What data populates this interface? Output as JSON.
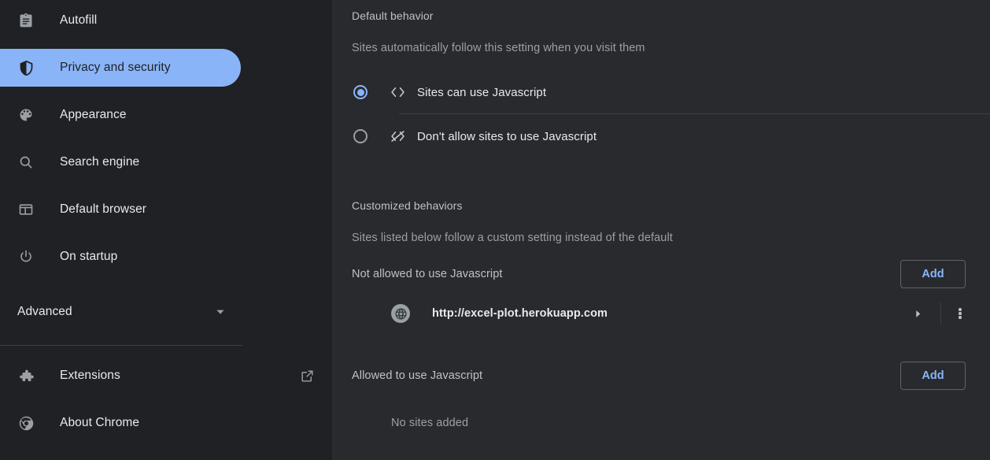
{
  "sidebar": {
    "items": [
      {
        "label": "Autofill",
        "icon": "clipboard-icon",
        "selected": false
      },
      {
        "label": "Privacy and security",
        "icon": "shield-icon",
        "selected": true
      },
      {
        "label": "Appearance",
        "icon": "palette-icon",
        "selected": false
      },
      {
        "label": "Search engine",
        "icon": "search-icon",
        "selected": false
      },
      {
        "label": "Default browser",
        "icon": "browser-window-icon",
        "selected": false
      },
      {
        "label": "On startup",
        "icon": "power-icon",
        "selected": false
      }
    ],
    "advanced": {
      "label": "Advanced",
      "icon": "chevron-down-icon"
    },
    "footer": [
      {
        "label": "Extensions",
        "icon": "puzzle-piece-icon",
        "trailing_icon": "external-link-icon"
      },
      {
        "label": "About Chrome",
        "icon": "chrome-logo-icon",
        "trailing_icon": ""
      }
    ]
  },
  "main": {
    "default_behavior": {
      "title": "Default behavior",
      "description": "Sites automatically follow this setting when you visit them",
      "options": [
        {
          "label": "Sites can use Javascript",
          "icon": "code-brackets-icon",
          "selected": true
        },
        {
          "label": "Don't allow sites to use Javascript",
          "icon": "code-brackets-blocked-icon",
          "selected": false
        }
      ]
    },
    "customized_behaviors": {
      "title": "Customized behaviors",
      "description": "Sites listed below follow a custom setting instead of the default",
      "groups": [
        {
          "label": "Not allowed to use Javascript",
          "add_label": "Add",
          "sites": [
            {
              "url": "http://excel-plot.herokuapp.com",
              "icon": "globe-icon",
              "expand_icon": "chevron-right-icon",
              "menu_icon": "kebab-menu-icon"
            }
          ],
          "empty_text": ""
        },
        {
          "label": "Allowed to use Javascript",
          "add_label": "Add",
          "sites": [],
          "empty_text": "No sites added"
        }
      ]
    }
  },
  "colors": {
    "accent": "#8ab4f8",
    "sidebar_bg": "#202124",
    "main_bg": "#292a2d",
    "divider": "#3c4043",
    "text_primary": "#e8eaed",
    "text_secondary": "#9aa0a6"
  }
}
